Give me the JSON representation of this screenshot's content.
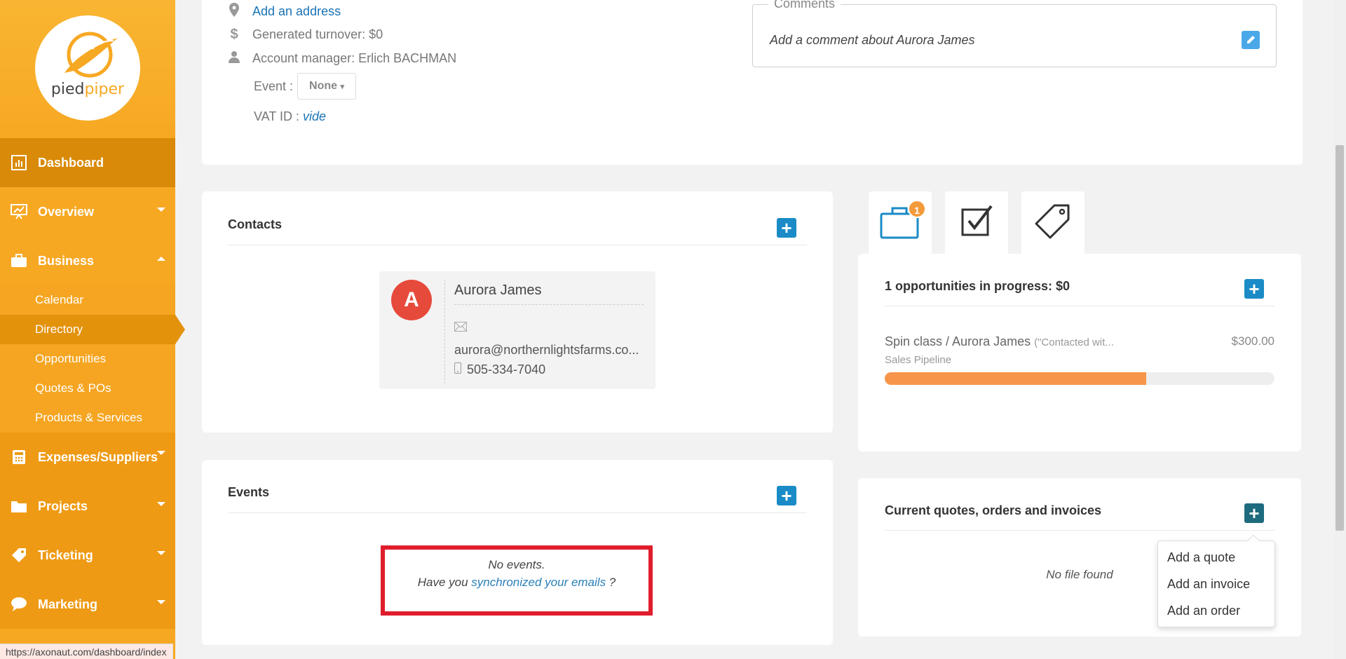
{
  "brand": {
    "name_part1": "pied",
    "name_part2": "piper"
  },
  "status_url": "https://axonaut.com/dashboard/index",
  "sidebar": {
    "items": [
      {
        "label": "Dashboard",
        "icon": "bar-chart-icon"
      },
      {
        "label": "Overview",
        "icon": "presentation-chart-icon"
      },
      {
        "label": "Business",
        "icon": "briefcase-icon"
      },
      {
        "label": "Expenses/Suppliers",
        "icon": "calculator-icon"
      },
      {
        "label": "Projects",
        "icon": "folder-icon"
      },
      {
        "label": "Ticketing",
        "icon": "tag-icon"
      },
      {
        "label": "Marketing",
        "icon": "chat-bubble-icon"
      }
    ],
    "business_sub": [
      "Calendar",
      "Directory",
      "Opportunities",
      "Quotes & POs",
      "Products & Services"
    ]
  },
  "info": {
    "address_link": "Add an address",
    "turnover": "Generated turnover: $0",
    "manager": "Account manager: Erlich BACHMAN",
    "event_label": "Event :",
    "event_value": "None",
    "vat_label": "VAT ID :",
    "vat_value": "vide",
    "comments_legend": "Comments",
    "comments_placeholder": "Add a comment about Aurora James"
  },
  "contacts": {
    "title": "Contacts",
    "contact": {
      "initial": "A",
      "name": "Aurora James",
      "email": "aurora@northernlightsfarms.co...",
      "phone": "505-334-7040"
    }
  },
  "events": {
    "title": "Events",
    "empty_text": "No events.",
    "sync_prefix": "Have you ",
    "sync_link": "synchronized your emails",
    "sync_suffix": " ?"
  },
  "tabs": {
    "briefcase_badge": "1"
  },
  "opportunities": {
    "title": "1 opportunities in progress: $0",
    "item_name": "Spin class / Aurora James",
    "item_note": "(\"Contacted wit...",
    "item_amount": "$300.00",
    "item_pipeline": "Sales Pipeline",
    "progress": 0.67
  },
  "quotes": {
    "title": "Current quotes, orders and invoices",
    "empty_text": "No file found",
    "menu": [
      "Add a quote",
      "Add an invoice",
      "Add an order"
    ]
  },
  "colors": {
    "sidebar": "#f7a823",
    "accent_blue": "#1a8bc6",
    "progress_fill": "#f7964a",
    "highlight_box": "#e01d2b"
  }
}
